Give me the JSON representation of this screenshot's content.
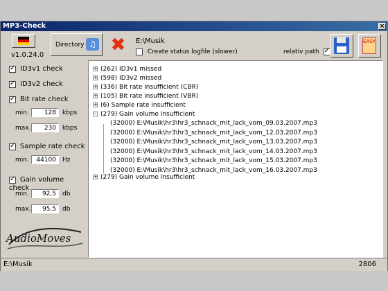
{
  "window": {
    "title": "MP3-Check",
    "close_glyph": "×"
  },
  "toolbar": {
    "version": "v1.0.24.0",
    "directory_label": "Directory",
    "path": "E:\\Musik",
    "status_logfile_label": "Create status logfile (slower)",
    "status_logfile_checked": false,
    "relativ_path_label": "relativ path",
    "relativ_path_checked": true,
    "easy_label": "EASY"
  },
  "options": {
    "id3v1": {
      "label": "ID3v1 check",
      "checked": true
    },
    "id3v2": {
      "label": "ID3v2 check",
      "checked": true
    },
    "bitrate": {
      "label": "Bit rate check",
      "checked": true,
      "min_label": "min.",
      "min_value": "128",
      "max_label": "max.",
      "max_value": "230",
      "unit": "kbps"
    },
    "samplerate": {
      "label": "Sample rate check",
      "checked": true,
      "min_label": "min.",
      "min_value": "44100",
      "unit": "Hz"
    },
    "gain": {
      "label": "Gain volume check",
      "checked": true,
      "min_label": "min.",
      "min_value": "92,5",
      "max_label": "max.",
      "max_value": "95,5",
      "unit": "db"
    }
  },
  "logo_text": "AudioMoves",
  "tree": {
    "nodes": [
      {
        "expander": "+",
        "label": "(262) ID3v1 missed"
      },
      {
        "expander": "+",
        "label": "(598) ID3v2 missed"
      },
      {
        "expander": "+",
        "label": "(336) Bit rate insufficient (CBR)"
      },
      {
        "expander": "+",
        "label": "(105) Bit rate insufficient (VBR)"
      },
      {
        "expander": "+",
        "label": "(6) Sample rate insufficient"
      },
      {
        "expander": "-",
        "label": "(279) Gain volume insufficient"
      },
      {
        "expander": "+",
        "label": "(279) Gain volume insufficient"
      }
    ],
    "children": [
      "(32000) E:\\Musik\\hr3\\hr3_schnack_mit_lack_vom_09.03.2007.mp3",
      "(32000) E:\\Musik\\hr3\\hr3_schnack_mit_lack_vom_12.03.2007.mp3",
      "(32000) E:\\Musik\\hr3\\hr3_schnack_mit_lack_vom_13.03.2007.mp3",
      "(32000) E:\\Musik\\hr3\\hr3_schnack_mit_lack_vom_14.03.2007.mp3",
      "(32000) E:\\Musik\\hr3\\hr3_schnack_mit_lack_vom_15.03.2007.mp3",
      "(32000) E:\\Musik\\hr3\\hr3_schnack_mit_lack_vom_16.03.2007.mp3"
    ]
  },
  "statusbar": {
    "path": "E:\\Musik",
    "count": "2806"
  }
}
